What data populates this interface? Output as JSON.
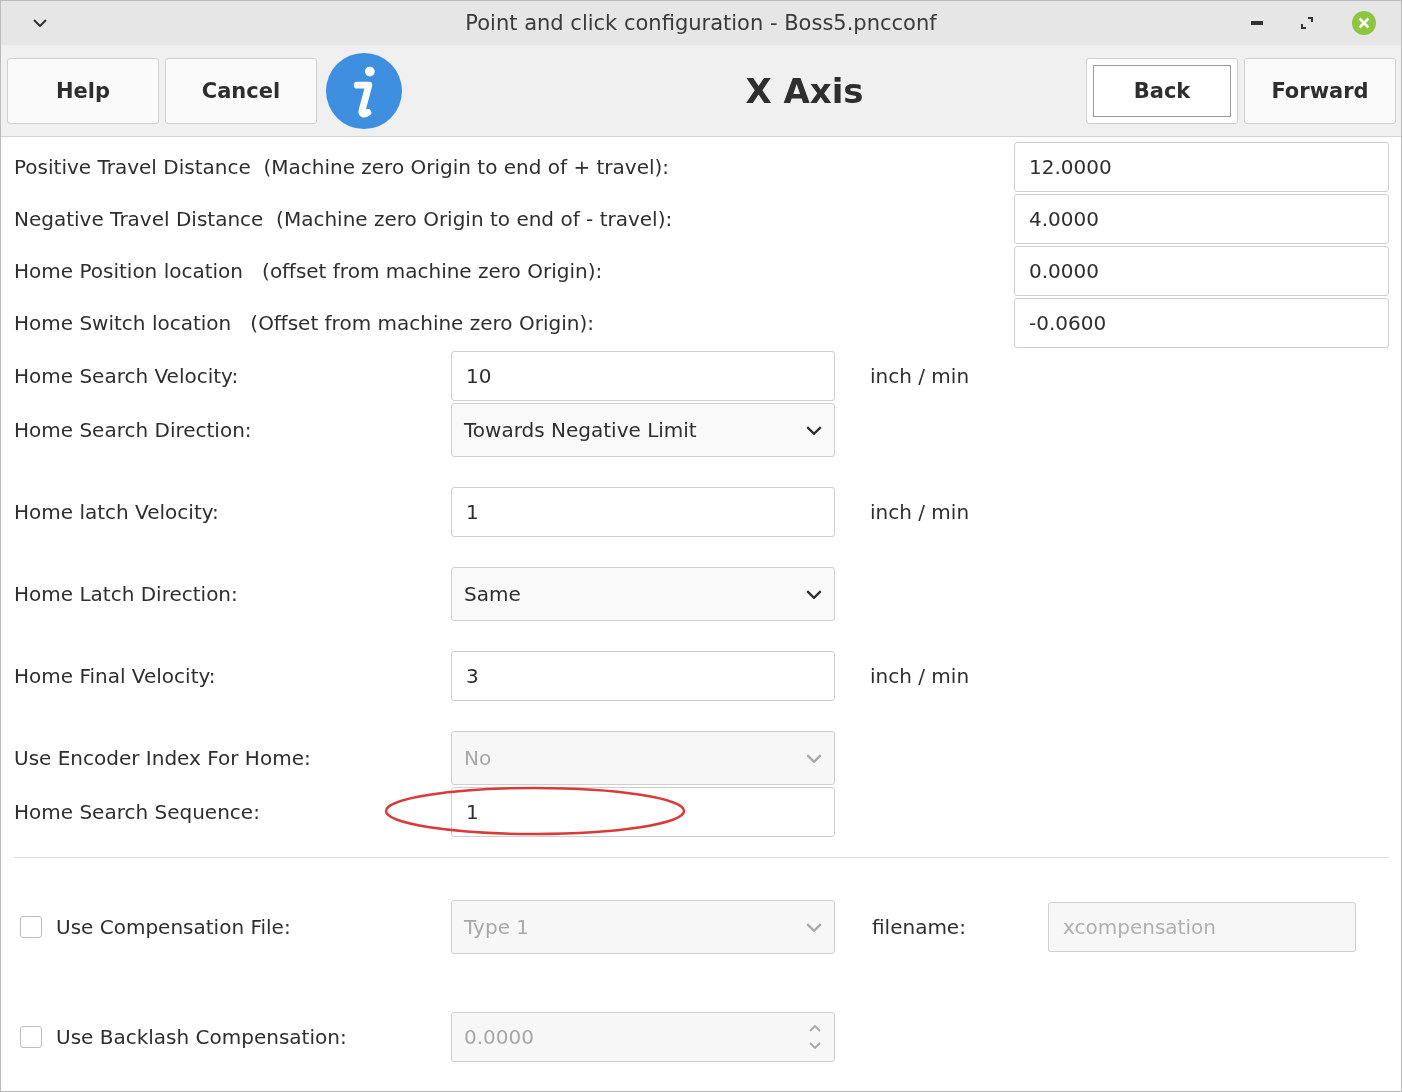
{
  "window": {
    "title": "Point and click configuration - Boss5.pncconf"
  },
  "toolbar": {
    "left_buttons": [
      "Help",
      "Cancel"
    ],
    "page_title": "X Axis",
    "right_buttons": [
      {
        "label": "Back",
        "focused": true
      },
      {
        "label": "Forward",
        "focused": false
      }
    ]
  },
  "travel_rows": [
    {
      "label": "Positive Travel Distance  (Machine zero Origin to end of + travel):",
      "value": "12.0000"
    },
    {
      "label": "Negative Travel Distance  (Machine zero Origin to end of - travel):",
      "value": "4.0000"
    },
    {
      "label": "Home Position location   (offset from machine zero Origin):",
      "value": "0.0000"
    },
    {
      "label": "Home Switch location   (Offset from machine zero Origin):",
      "value": "-0.0600"
    }
  ],
  "home_rows": [
    {
      "kind": "entry",
      "label": "Home Search Velocity:",
      "value": "10",
      "unit": "inch / min",
      "disabled": false
    },
    {
      "kind": "combo",
      "label": "Home Search Direction:",
      "value": "Towards Negative Limit",
      "disabled": false
    },
    {
      "kind": "entry",
      "label": "Home latch Velocity:",
      "value": "1",
      "unit": "inch / min",
      "disabled": false
    },
    {
      "kind": "combo",
      "label": "Home Latch Direction:",
      "value": "Same",
      "disabled": false
    },
    {
      "kind": "entry",
      "label": "Home Final Velocity:",
      "value": "3",
      "unit": "inch / min",
      "disabled": false
    },
    {
      "kind": "combo",
      "label": "Use Encoder Index For Home:",
      "value": "No",
      "disabled": true
    },
    {
      "kind": "entry",
      "label": "Home Search Sequence:",
      "value": "1",
      "disabled": false
    }
  ],
  "compensation_rows": [
    {
      "kind": "combo",
      "label": "Use Compensation File:",
      "checked": false,
      "value": "Type 1",
      "disabled": true,
      "file_label": "filename:",
      "file_value": "xcompensation"
    },
    {
      "kind": "spin",
      "label": "Use Backlash Compensation:",
      "checked": false,
      "value": "0.0000",
      "disabled": true
    }
  ]
}
